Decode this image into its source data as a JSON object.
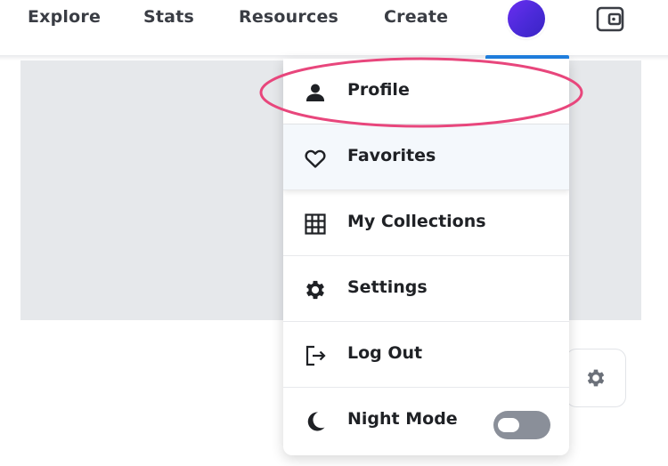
{
  "nav": {
    "links": [
      "Explore",
      "Stats",
      "Resources",
      "Create"
    ],
    "avatar_icon": "user-avatar",
    "wallet_icon": "wallet-icon"
  },
  "menu": {
    "items": [
      {
        "label": "Profile",
        "icon": "person-icon"
      },
      {
        "label": "Favorites",
        "icon": "heart-icon"
      },
      {
        "label": "My Collections",
        "icon": "grid-icon"
      },
      {
        "label": "Settings",
        "icon": "gear-icon"
      },
      {
        "label": "Log Out",
        "icon": "logout-icon"
      },
      {
        "label": "Night Mode",
        "icon": "moon-icon",
        "toggle_on": false
      }
    ]
  },
  "colors": {
    "accent": "#2081e2",
    "highlight": "#e8467c",
    "avatar": "#4a2ad8"
  }
}
